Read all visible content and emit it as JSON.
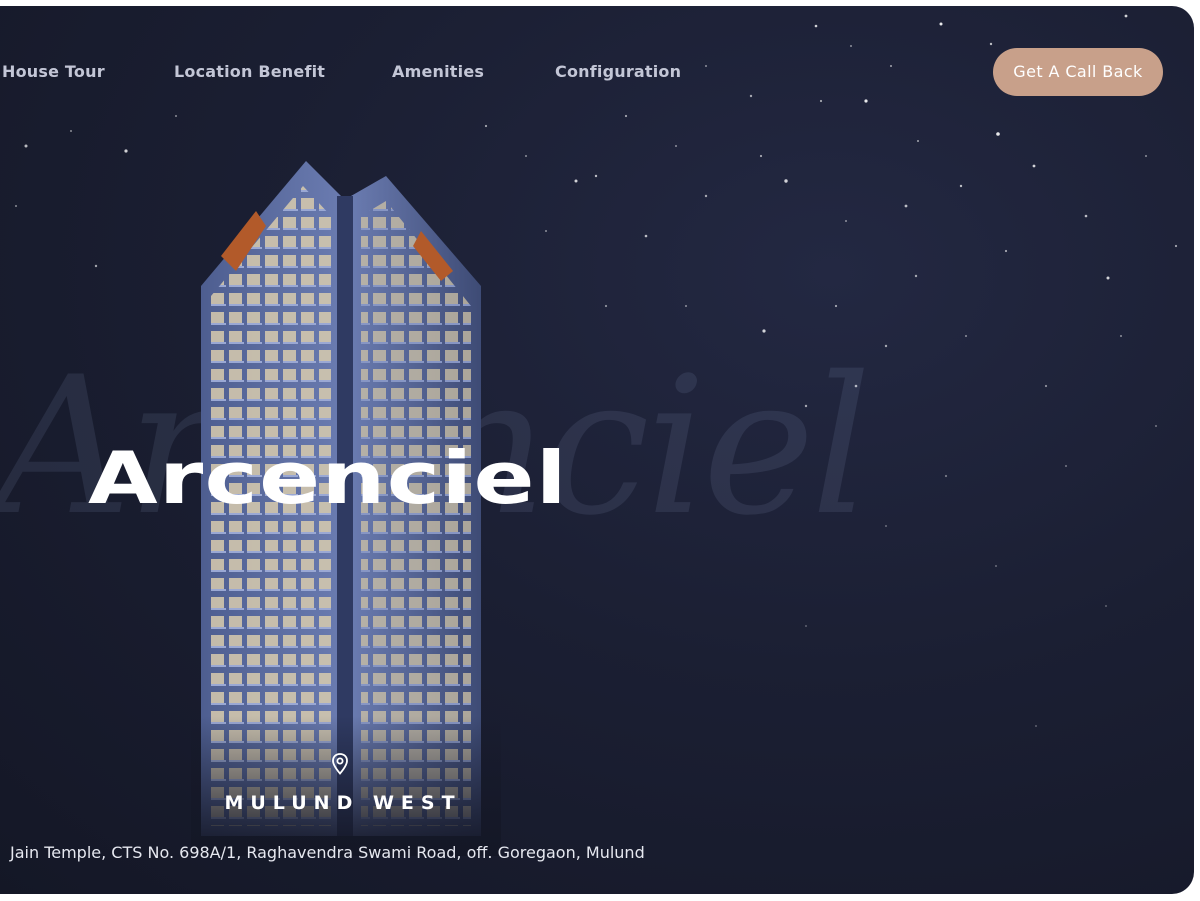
{
  "nav": {
    "items": [
      {
        "label": "House Tour"
      },
      {
        "label": "Location Benefit"
      },
      {
        "label": "Amenities"
      },
      {
        "label": "Configuration"
      }
    ],
    "cta_label": "Get A Call Back"
  },
  "hero": {
    "brand": "Arcenciel",
    "script_word": "Arcenciel",
    "location_icon": "map-pin-icon",
    "location": "MULUND WEST",
    "address": "Jain Temple, CTS No. 698A/1, Raghavendra Swami Road, off. Goregaon, Mulund"
  },
  "colors": {
    "background": "#1b1f33",
    "cta": "#c8a08a",
    "nav_text": "#c3c6d6",
    "accent_orange": "#b25a2a"
  }
}
